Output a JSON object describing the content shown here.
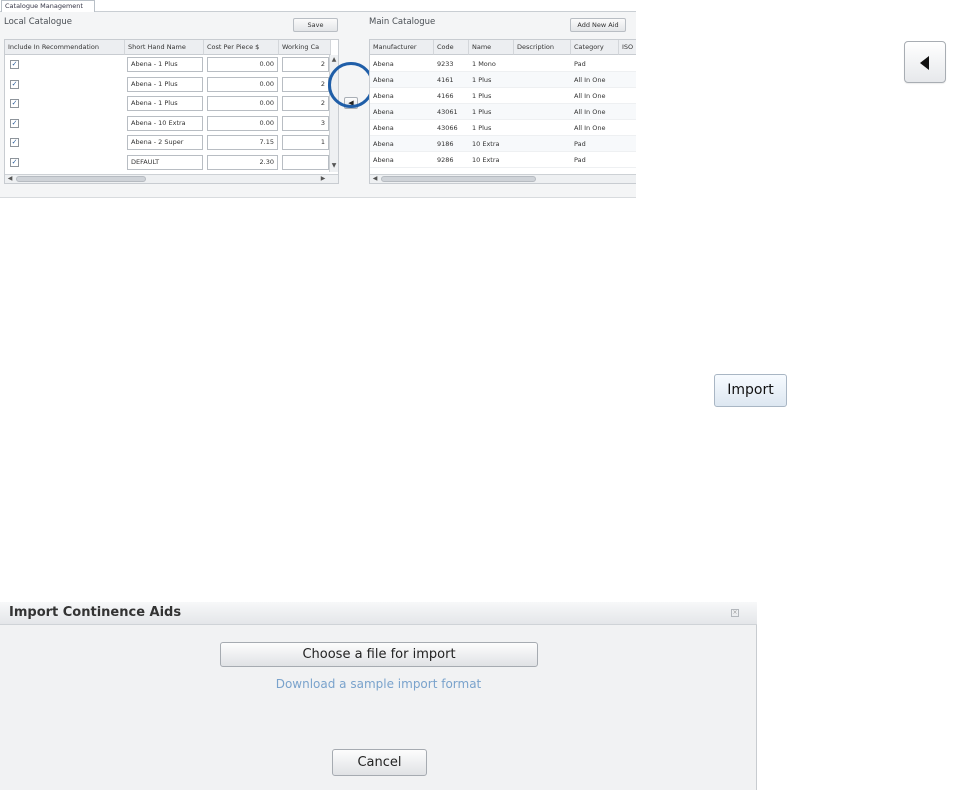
{
  "catalogue": {
    "tab_label": "Catalogue Management",
    "local": {
      "title": "Local Catalogue",
      "save_label": "Save",
      "columns": [
        "Include In Recommendation",
        "Short Hand Name",
        "Cost Per Piece $",
        "Working Ca"
      ],
      "rows": [
        {
          "checked": true,
          "name": "Abena - 1 Plus",
          "cost": "0.00",
          "working": "2"
        },
        {
          "checked": true,
          "name": "Abena - 1 Plus",
          "cost": "0.00",
          "working": "2"
        },
        {
          "checked": true,
          "name": "Abena - 1 Plus",
          "cost": "0.00",
          "working": "2"
        },
        {
          "checked": true,
          "name": "Abena - 10 Extra",
          "cost": "0.00",
          "working": "3"
        },
        {
          "checked": true,
          "name": "Abena - 2 Super",
          "cost": "7.15",
          "working": "1"
        },
        {
          "checked": true,
          "name": "DEFAULT",
          "cost": "2.30",
          "working": ""
        }
      ]
    },
    "transfer_icon": "arrow-left-icon",
    "main": {
      "title": "Main Catalogue",
      "add_label": "Add New Aid",
      "columns": [
        "Manufacturer",
        "Code",
        "Name",
        "Description",
        "Category",
        "ISO"
      ],
      "rows": [
        {
          "manufacturer": "Abena",
          "code": "9233",
          "name": "1 Mono",
          "description": "",
          "category": "Pad"
        },
        {
          "manufacturer": "Abena",
          "code": "4161",
          "name": "1 Plus",
          "description": "",
          "category": "All In One"
        },
        {
          "manufacturer": "Abena",
          "code": "4166",
          "name": "1 Plus",
          "description": "",
          "category": "All In One"
        },
        {
          "manufacturer": "Abena",
          "code": "43061",
          "name": "1 Plus",
          "description": "",
          "category": "All In One"
        },
        {
          "manufacturer": "Abena",
          "code": "43066",
          "name": "1 Plus",
          "description": "",
          "category": "All In One"
        },
        {
          "manufacturer": "Abena",
          "code": "9186",
          "name": "10 Extra",
          "description": "",
          "category": "Pad"
        },
        {
          "manufacturer": "Abena",
          "code": "9286",
          "name": "10 Extra",
          "description": "",
          "category": "Pad"
        }
      ]
    }
  },
  "arrow_button": {
    "icon": "arrow-left-icon"
  },
  "import_button": {
    "label": "Import"
  },
  "import_dialog": {
    "title": "Import Continence Aids",
    "choose_label": "Choose a file for import",
    "download_link": "Download a sample import format",
    "cancel_label": "Cancel"
  },
  "colors": {
    "accent_ring": "#1f5ea8",
    "link": "#7aa3cc"
  }
}
